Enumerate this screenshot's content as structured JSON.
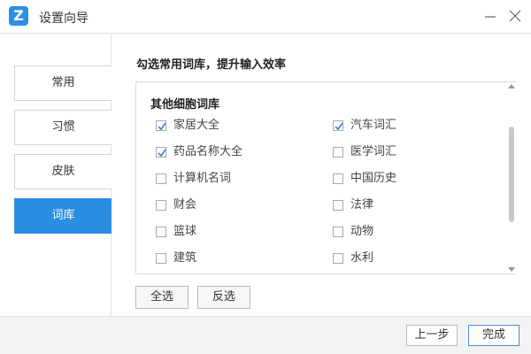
{
  "window": {
    "title": "设置向导",
    "logo_letter": "Z"
  },
  "sidebar": {
    "items": [
      {
        "label": "常用",
        "active": false
      },
      {
        "label": "习惯",
        "active": false
      },
      {
        "label": "皮肤",
        "active": false
      },
      {
        "label": "词库",
        "active": true
      }
    ]
  },
  "main": {
    "section_title": "勾选常用词库，提升输入效率",
    "panel_title": "其他细胞词库",
    "items": [
      {
        "label": "家居大全",
        "checked": true
      },
      {
        "label": "汽车词汇",
        "checked": true
      },
      {
        "label": "药品名称大全",
        "checked": true
      },
      {
        "label": "医学词汇",
        "checked": false
      },
      {
        "label": "计算机名词",
        "checked": false
      },
      {
        "label": "中国历史",
        "checked": false
      },
      {
        "label": "财会",
        "checked": false
      },
      {
        "label": "法律",
        "checked": false
      },
      {
        "label": "篮球",
        "checked": false
      },
      {
        "label": "动物",
        "checked": false
      },
      {
        "label": "建筑",
        "checked": false
      },
      {
        "label": "水利",
        "checked": false
      }
    ],
    "select_all_label": "全选",
    "invert_label": "反选"
  },
  "footer": {
    "prev_label": "上一步",
    "finish_label": "完成"
  },
  "colors": {
    "accent": "#2a8ee2",
    "check": "#3b7fd0"
  }
}
